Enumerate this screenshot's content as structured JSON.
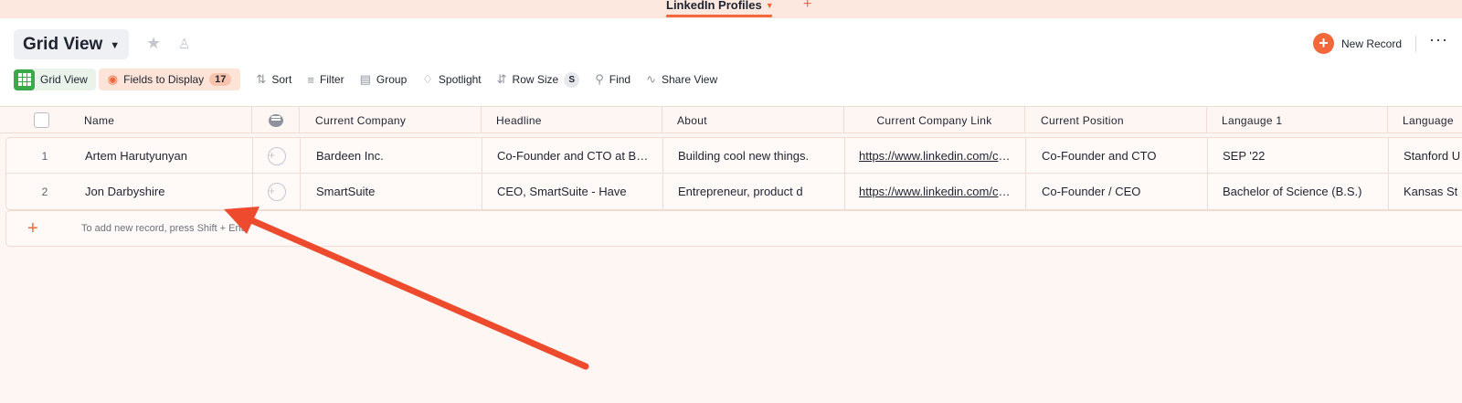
{
  "tabs": {
    "active_label": "LinkedIn Profiles",
    "add_label": "+"
  },
  "header": {
    "view_title": "Grid View",
    "new_record_label": "New Record",
    "more_label": "···"
  },
  "toolbar": {
    "grid_view_label": "Grid View",
    "fields_label": "Fields to Display",
    "fields_count": "17",
    "sort_label": "Sort",
    "filter_label": "Filter",
    "group_label": "Group",
    "spotlight_label": "Spotlight",
    "row_size_label": "Row Size",
    "row_size_value": "S",
    "find_label": "Find",
    "share_label": "Share View"
  },
  "table": {
    "columns": [
      "Name",
      "",
      "Current Company",
      "Headline",
      "About",
      "Current Company Link",
      "Current Position",
      "Langauge 1",
      "Language"
    ],
    "rows": [
      {
        "num": "1",
        "name": "Artem Harutyunyan",
        "company": "Bardeen Inc.",
        "headline": "Co-Founder and CTO at Bardeen",
        "about": "Building cool new things.",
        "link": "https://www.linkedin.com/company/bardeen",
        "position": "Co-Founder and CTO",
        "lang1": "SEP '22",
        "lang2": "Stanford U"
      },
      {
        "num": "2",
        "name": "Jon Darbyshire",
        "company": "SmartSuite",
        "headline": "CEO, SmartSuite - Have",
        "about": "Entrepreneur, product d",
        "link": "https://www.linkedin.com/company/smartsuite",
        "position": "Co-Founder / CEO",
        "lang1": "Bachelor of Science (B.S.)",
        "lang2": "Kansas St"
      }
    ],
    "add_hint": "To add new record, press Shift + Ente"
  },
  "colors": {
    "accent": "#f2683a",
    "grid_green": "#3aa94a",
    "annotation_arrow": "#ee4a2e"
  }
}
